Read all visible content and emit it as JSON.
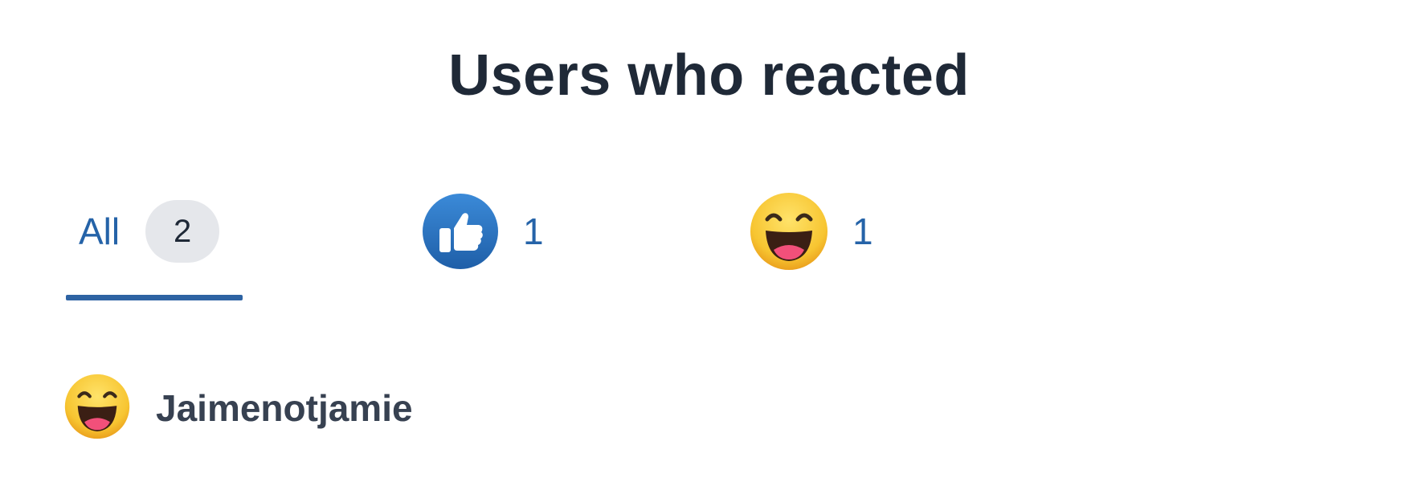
{
  "title": "Users who reacted",
  "tabs": [
    {
      "label": "All",
      "count": "2",
      "active": true
    },
    {
      "icon": "thumbs-up-icon",
      "count": "1"
    },
    {
      "icon": "laughing-face-icon",
      "count": "1"
    }
  ],
  "users": [
    {
      "name": "Jaimenotjamie",
      "reaction_icon": "laughing-face-icon"
    }
  ],
  "colors": {
    "accent": "#2563a8",
    "title": "#1f2937",
    "pill_bg": "#e5e7eb"
  }
}
